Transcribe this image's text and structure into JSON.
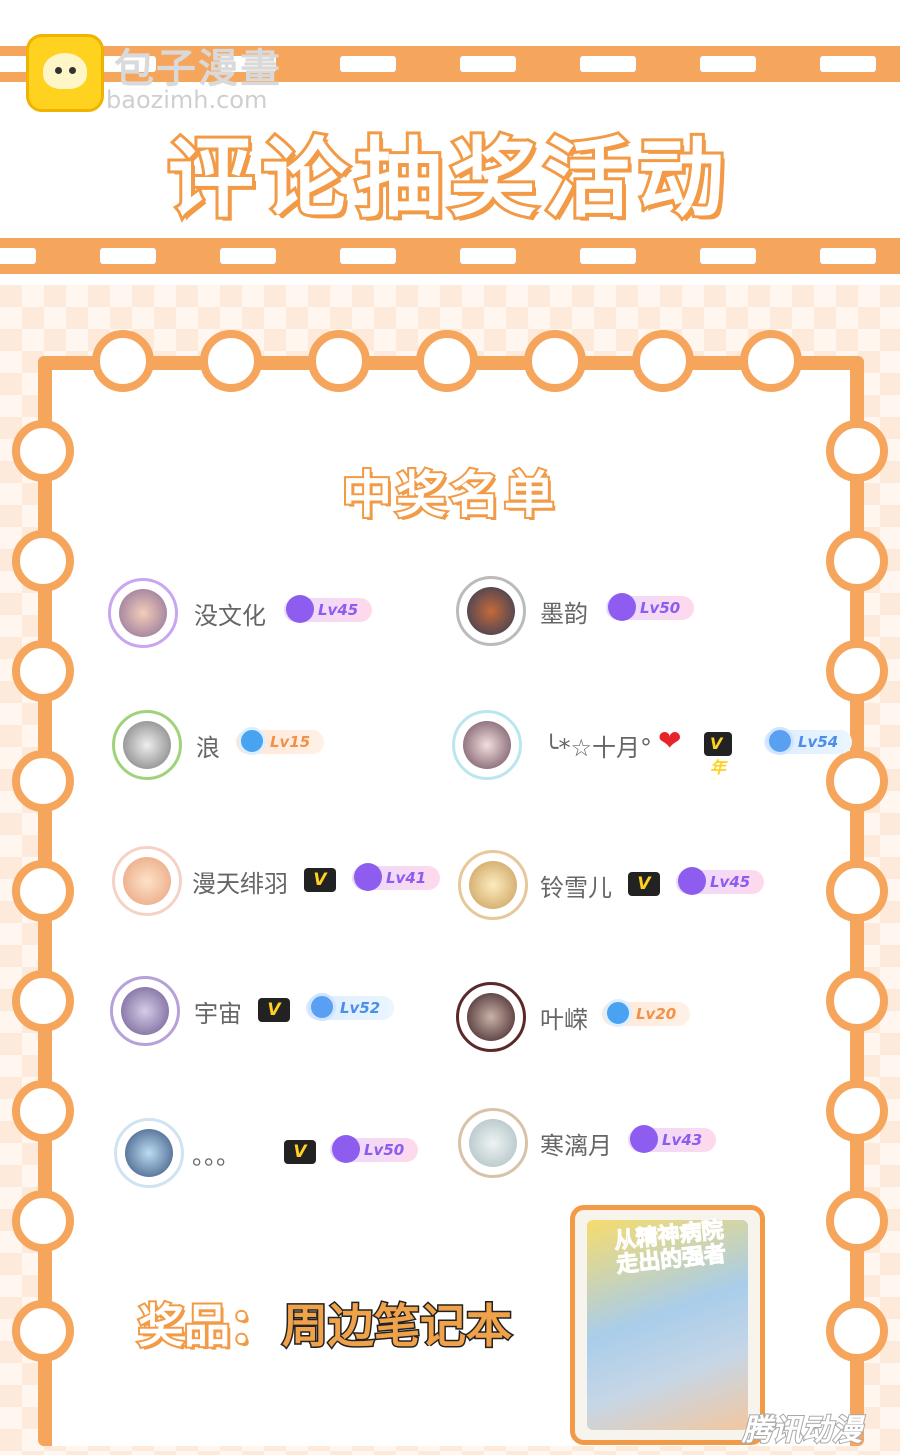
{
  "site": {
    "name": "包子漫畫",
    "url": "baozimh.com"
  },
  "event_title": "评论抽奖活动",
  "winners_heading": "中奖名单",
  "winners": [
    {
      "name": "没文化",
      "level": "Lv45",
      "vip": false
    },
    {
      "name": "墨韵",
      "level": "Lv50",
      "vip": false
    },
    {
      "name": "浪",
      "level": "Lv15",
      "vip": false
    },
    {
      "name": "╰*☆十月°",
      "level": "Lv54",
      "vip": true,
      "vip_label": "V年"
    },
    {
      "name": "漫天绯羽",
      "level": "Lv41",
      "vip": true,
      "vip_label": "V"
    },
    {
      "name": "铃雪儿",
      "level": "Lv45",
      "vip": true,
      "vip_label": "V"
    },
    {
      "name": "宇宙",
      "level": "Lv52",
      "vip": true,
      "vip_label": "V"
    },
    {
      "name": "叶嵘",
      "level": "Lv20",
      "vip": false
    },
    {
      "name": "。。。",
      "level": "Lv50",
      "vip": true,
      "vip_label": "V"
    },
    {
      "name": "寒漓月",
      "level": "Lv43",
      "vip": false
    }
  ],
  "prize": {
    "label": "奖品：",
    "value": "周边笔记本"
  },
  "notebook_cover_title": "从精神病院走出的强者",
  "watermark": "腾讯动漫",
  "colors": {
    "accent": "#f29a45",
    "level_purple": "#8a5cf0",
    "level_blue": "#4a8ee8"
  }
}
